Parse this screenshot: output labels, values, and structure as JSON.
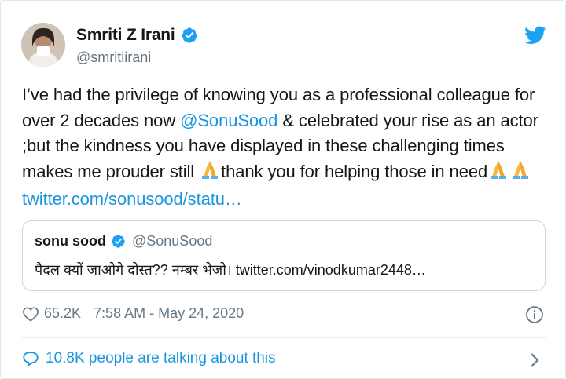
{
  "author": {
    "name": "Smriti Z Irani",
    "handle": "@smritiirani",
    "verified": true
  },
  "tweet": {
    "text_part1": "I’ve had the privilege of knowing you as a professional colleague for over 2 decades now ",
    "mention": "@SonuSood",
    "text_part2": " & celebrated your rise as an actor ;but the kindness you have displayed in these challenging times makes me prouder still ",
    "text_part3": "thank you for helping those in need",
    "link": "twitter.com/sonusood/statu…"
  },
  "quoted_tweet": {
    "name": "sonu sood",
    "handle": "@SonuSood",
    "verified": true,
    "text": "पैदल क्यों जाओगे दोस्त?? नम्बर भेजो। twitter.com/vinodkumar2448…"
  },
  "meta": {
    "likes": "65.2K",
    "timestamp": "7:58 AM - May 24, 2020"
  },
  "footer": {
    "talking_text": "10.8K people are talking about this"
  },
  "icons": {
    "verified": "verified-badge-icon",
    "twitter": "twitter-bird-icon",
    "like": "heart-icon",
    "info": "info-icon",
    "reply": "speech-bubble-icon",
    "chevron": "chevron-right-icon",
    "emoji": "folded-hands-icon"
  },
  "colors": {
    "brand": "#1da1f2",
    "link": "#1b95e0",
    "secondary_text": "#657786",
    "border": "#ccd6dd"
  }
}
